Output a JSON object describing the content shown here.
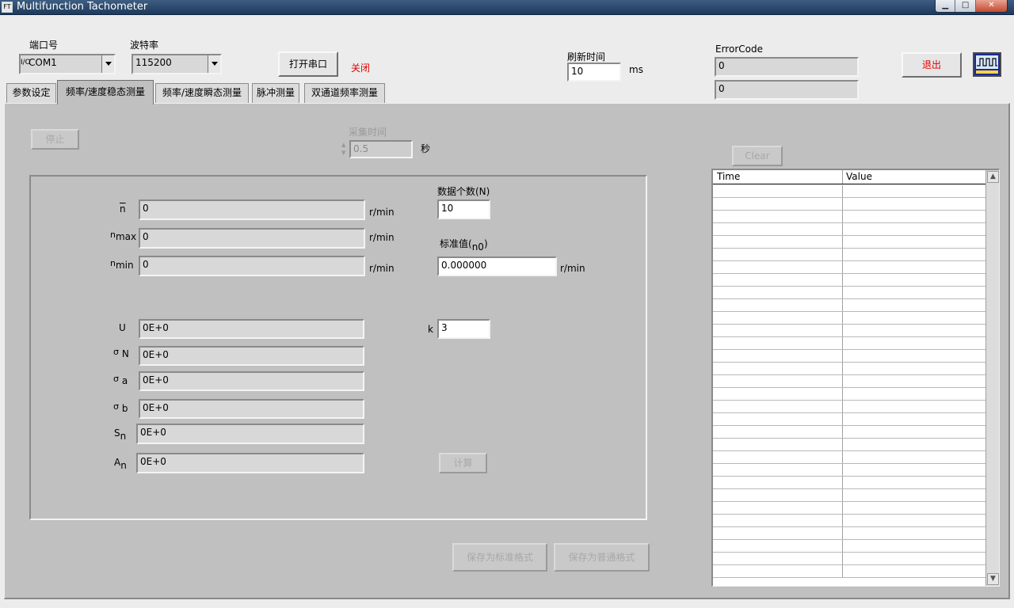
{
  "window": {
    "title": "Multifunction Tachometer",
    "icon_text": "FT"
  },
  "header": {
    "port_label": "端口号",
    "port_value": "COM1",
    "port_prefix": "I/O",
    "baud_label": "波特率",
    "baud_value": "115200",
    "open_port_button": "打开串口",
    "port_status": "关闭",
    "refresh_label": "刷新时间",
    "refresh_value": "10",
    "refresh_unit": "ms",
    "error_label": "ErrorCode",
    "error_value_1": "0",
    "error_value_2": "0",
    "exit_button": "退出"
  },
  "tabs": [
    {
      "label": "参数设定"
    },
    {
      "label": "频率/速度稳态测量"
    },
    {
      "label": "频率/速度瞬态测量"
    },
    {
      "label": "脉冲测量"
    },
    {
      "label": "双通道频率测量"
    }
  ],
  "panel": {
    "stop_button": "停止",
    "sample_time_label": "采集时间",
    "sample_time_value": "0.5",
    "sample_time_unit": "秒",
    "clear_button": "Clear",
    "n_mean_label": "n",
    "n_mean_value": "0",
    "n_max_label": "n",
    "n_max_sub": "max",
    "n_max_value": "0",
    "n_min_label": "n",
    "n_min_sub": "min",
    "n_min_value": "0",
    "unit_rmin": "r/min",
    "count_label": "数据个数(N)",
    "count_value": "10",
    "standard_label": "标准值(",
    "standard_sub": "n0",
    "standard_close": ")",
    "standard_value": "0.000000",
    "u_label": "U",
    "u_value": "0E+0",
    "k_label": "k",
    "k_value": "3",
    "sigma_n_label": "σ",
    "sigma_n_sub": "N",
    "sigma_n_value": "0E+0",
    "sigma_a_label": "σ",
    "sigma_a_sub": "a",
    "sigma_a_value": "0E+0",
    "sigma_b_label": "σ",
    "sigma_b_sub": "b",
    "sigma_b_value": "0E+0",
    "sn_label": "S",
    "sn_sub": "n",
    "sn_value": "0E+0",
    "an_label": "A",
    "an_sub": "n",
    "an_value": "0E+0",
    "calc_button": "计算",
    "save_std_button": "保存为标准格式",
    "save_plain_button": "保存为普通格式"
  },
  "table": {
    "columns": [
      "Time",
      "Value"
    ],
    "scroll_up": "▲",
    "scroll_down": "▼"
  },
  "colors": {
    "status_red": "#e00000",
    "panel_grey": "#c0c0c0",
    "title_blue": "#2a4a70"
  }
}
